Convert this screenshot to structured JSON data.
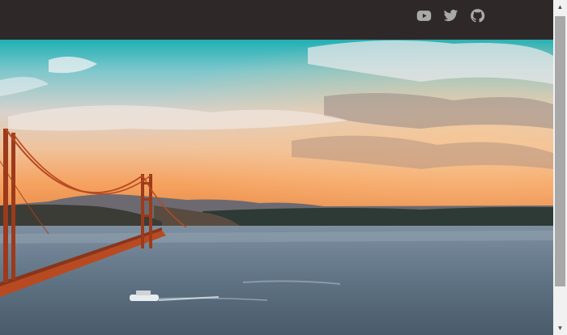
{
  "navbar": {
    "background": "#2e2829",
    "icon_color": "#a9a9a9",
    "social_links": [
      {
        "icon": "youtube-icon"
      },
      {
        "icon": "twitter-icon"
      },
      {
        "icon": "github-icon"
      }
    ]
  },
  "hero": {
    "image_subject": "golden-gate-bridge-sunset"
  },
  "scrollbar": {
    "up_glyph": "▲",
    "down_glyph": "▼",
    "track_color": "#f1f1f1",
    "thumb_color": "#a8a8a8"
  }
}
